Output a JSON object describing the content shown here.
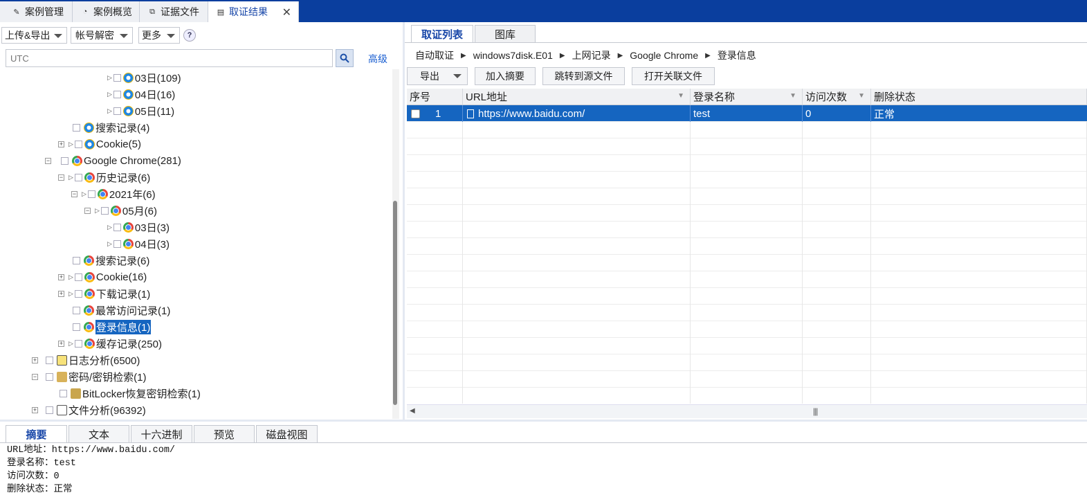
{
  "top_tabs": [
    {
      "label": "案例管理",
      "icon": "edit-icon"
    },
    {
      "label": "案例概览",
      "icon": "pie-chart-icon"
    },
    {
      "label": "证据文件",
      "icon": "copy-icon"
    },
    {
      "label": "取证结果",
      "icon": "report-icon"
    }
  ],
  "left_toolbar": {
    "upload_export": "上传&导出",
    "account_decrypt": "帐号解密",
    "more": "更多",
    "help": "?"
  },
  "search": {
    "placeholder": "UTC",
    "advanced": "高级"
  },
  "tree": [
    {
      "label": "03日(109)",
      "icon": "ie"
    },
    {
      "label": "04日(16)",
      "icon": "ie"
    },
    {
      "label": "05日(11)",
      "icon": "ie"
    },
    {
      "label": "搜索记录(4)",
      "icon": "ie"
    },
    {
      "label": "Cookie(5)",
      "icon": "ie"
    },
    {
      "label": "Google Chrome(281)",
      "icon": "chrome"
    },
    {
      "label": "历史记录(6)",
      "icon": "chrome"
    },
    {
      "label": "2021年(6)",
      "icon": "chrome"
    },
    {
      "label": "05月(6)",
      "icon": "chrome"
    },
    {
      "label": "03日(3)",
      "icon": "chrome"
    },
    {
      "label": "04日(3)",
      "icon": "chrome"
    },
    {
      "label": "搜索记录(6)",
      "icon": "chrome"
    },
    {
      "label": "Cookie(16)",
      "icon": "chrome"
    },
    {
      "label": "下载记录(1)",
      "icon": "chrome"
    },
    {
      "label": "最常访问记录(1)",
      "icon": "chrome"
    },
    {
      "label": "登录信息(1)",
      "icon": "chrome"
    },
    {
      "label": "缓存记录(250)",
      "icon": "chrome"
    },
    {
      "label": "日志分析(6500)",
      "icon": "log"
    },
    {
      "label": "密码/密钥检索(1)",
      "icon": "key"
    },
    {
      "label": "BitLocker恢复密钥检索(1)",
      "icon": "key"
    },
    {
      "label": "文件分析(96392)",
      "icon": "file"
    }
  ],
  "right_tabs": {
    "list": "取证列表",
    "gallery": "图库"
  },
  "breadcrumb": [
    "自动取证",
    "windows7disk.E01",
    "上网记录",
    "Google Chrome",
    "登录信息"
  ],
  "right_toolbar": {
    "export": "导出",
    "add_summary": "加入摘要",
    "jump_source": "跳转到源文件",
    "open_related": "打开关联文件"
  },
  "grid": {
    "headers": [
      "序号",
      "URL地址",
      "登录名称",
      "访问次数",
      "删除状态"
    ],
    "rows": [
      {
        "index": "1",
        "url": "https://www.baidu.com/",
        "login": "test",
        "visits": "0",
        "status": "正常"
      }
    ]
  },
  "bottom_tabs": [
    "摘要",
    "文本",
    "十六进制",
    "预览",
    "磁盘视图"
  ],
  "summary_lines": [
    "URL地址：https://www.baidu.com/",
    "登录名称：test",
    "访问次数：0",
    "删除状态：正常"
  ]
}
